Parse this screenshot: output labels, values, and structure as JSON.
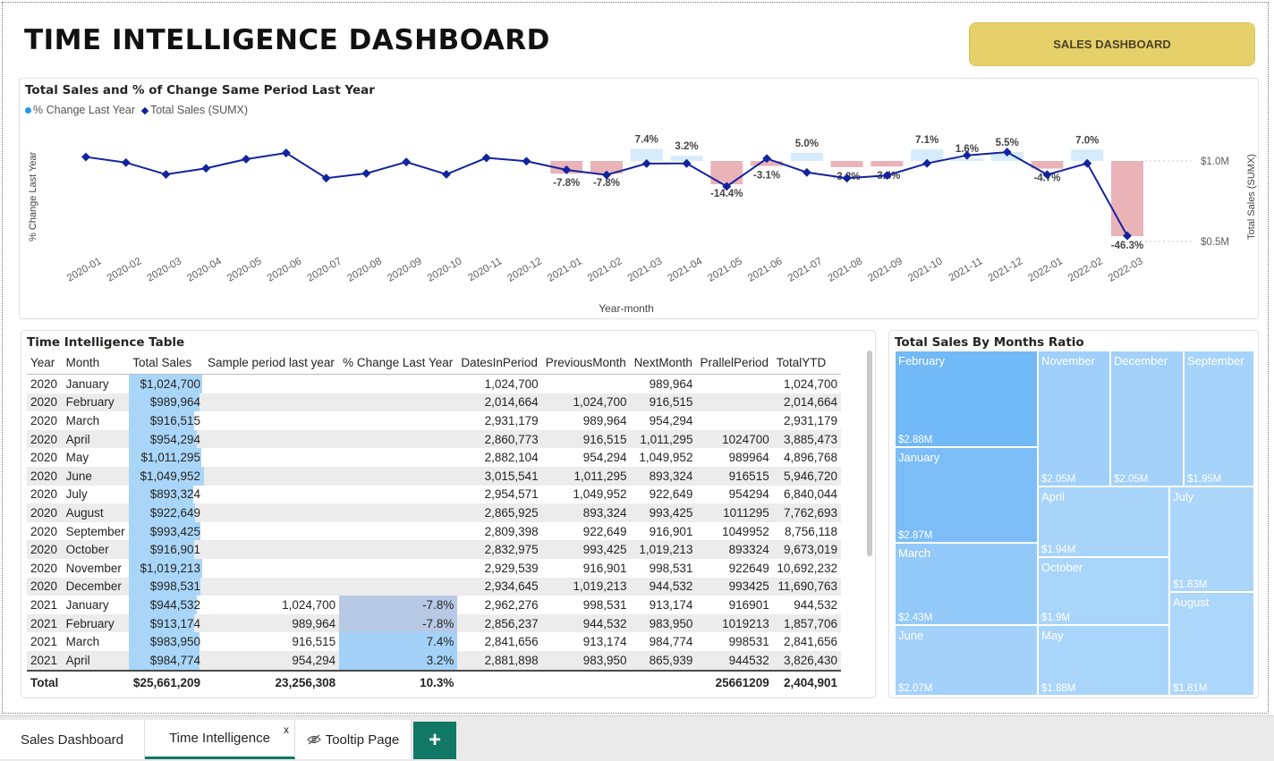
{
  "page_title": "TIME INTELLIGENCE DASHBOARD",
  "nav_button": "SALES DASHBOARD",
  "line_chart": {
    "title": "Total Sales and % of Change Same Period Last Year",
    "legend": [
      "% Change Last Year",
      "Total Sales (SUMX)"
    ],
    "left_axis_label": "% Change Last Year",
    "right_axis_label": "Total Sales (SUMX)",
    "right_ticks": [
      "$1.0M",
      "$0.5M"
    ],
    "x_axis_label": "Year-month"
  },
  "chart_data": {
    "type": "line",
    "x": [
      "2020-01",
      "2020-02",
      "2020-03",
      "2020-04",
      "2020-05",
      "2020-06",
      "2020-07",
      "2020-08",
      "2020-09",
      "2020-10",
      "2020-11",
      "2020-12",
      "2021-01",
      "2021-02",
      "2021-03",
      "2021-04",
      "2021-05",
      "2021-06",
      "2021-07",
      "2021-08",
      "2021-09",
      "2021-10",
      "2021-11",
      "2021-12",
      "2022-01",
      "2022-02",
      "2022-03"
    ],
    "series": [
      {
        "name": "Total Sales (SUMX)",
        "kind": "line",
        "axis": "right",
        "values": [
          1024700,
          989964,
          916515,
          954294,
          1011295,
          1049952,
          893324,
          922649,
          993425,
          916901,
          1019213,
          998531,
          944532,
          913174,
          983950,
          984774,
          842000,
          1015000,
          929000,
          893000,
          910000,
          985000,
          1035000,
          1055000,
          915000,
          985000,
          535000
        ]
      },
      {
        "name": "% Change Last Year",
        "kind": "bar",
        "axis": "left",
        "values": [
          null,
          null,
          null,
          null,
          null,
          null,
          null,
          null,
          null,
          null,
          null,
          null,
          -7.8,
          -7.8,
          7.4,
          3.2,
          -14.4,
          -3.1,
          5.0,
          -3.8,
          -3.4,
          7.1,
          1.6,
          5.5,
          -4.7,
          7.0,
          -46.3
        ],
        "labels": [
          "",
          "",
          "",
          "",
          "",
          "",
          "",
          "",
          "",
          "",
          "",
          "",
          "-7.8%",
          "-7.8%",
          "7.4%",
          "3.2%",
          "-14.4%",
          "-3.1%",
          "5.0%",
          "-3.8%",
          "-3.4%",
          "7.1%",
          "1.6%",
          "5.5%",
          "-4.7%",
          "7.0%",
          "-46.3%"
        ]
      }
    ],
    "right_axis_ticks": [
      1000000,
      500000
    ],
    "colors": {
      "line": "#12239e",
      "bar_negative": "#eab3b8",
      "bar_positive": "#d6ebfb"
    }
  },
  "table": {
    "title": "Time Intelligence Table",
    "headers": [
      "Year",
      "Month",
      "Total Sales",
      "Sample period last year",
      "% Change Last Year",
      "DatesInPeriod",
      "PreviousMonth",
      "NextMonth",
      "PrallelPeriod",
      "TotalYTD"
    ],
    "rows": [
      [
        "2020",
        "January",
        "$1,024,700",
        "",
        "",
        "1,024,700",
        "",
        "989,964",
        "",
        "1,024,700"
      ],
      [
        "2020",
        "February",
        "$989,964",
        "",
        "",
        "2,014,664",
        "1,024,700",
        "916,515",
        "",
        "2,014,664"
      ],
      [
        "2020",
        "March",
        "$916,515",
        "",
        "",
        "2,931,179",
        "989,964",
        "954,294",
        "",
        "2,931,179"
      ],
      [
        "2020",
        "April",
        "$954,294",
        "",
        "",
        "2,860,773",
        "916,515",
        "1,011,295",
        "1024700",
        "3,885,473"
      ],
      [
        "2020",
        "May",
        "$1,011,295",
        "",
        "",
        "2,882,104",
        "954,294",
        "1,049,952",
        "989964",
        "4,896,768"
      ],
      [
        "2020",
        "June",
        "$1,049,952",
        "",
        "",
        "3,015,541",
        "1,011,295",
        "893,324",
        "916515",
        "5,946,720"
      ],
      [
        "2020",
        "July",
        "$893,324",
        "",
        "",
        "2,954,571",
        "1,049,952",
        "922,649",
        "954294",
        "6,840,044"
      ],
      [
        "2020",
        "August",
        "$922,649",
        "",
        "",
        "2,865,925",
        "893,324",
        "993,425",
        "1011295",
        "7,762,693"
      ],
      [
        "2020",
        "September",
        "$993,425",
        "",
        "",
        "2,809,398",
        "922,649",
        "916,901",
        "1049952",
        "8,756,118"
      ],
      [
        "2020",
        "October",
        "$916,901",
        "",
        "",
        "2,832,975",
        "993,425",
        "1,019,213",
        "893324",
        "9,673,019"
      ],
      [
        "2020",
        "November",
        "$1,019,213",
        "",
        "",
        "2,929,539",
        "916,901",
        "998,531",
        "922649",
        "10,692,232"
      ],
      [
        "2020",
        "December",
        "$998,531",
        "",
        "",
        "2,934,645",
        "1,019,213",
        "944,532",
        "993425",
        "11,690,763"
      ],
      [
        "2021",
        "January",
        "$944,532",
        "1,024,700",
        "-7.8%",
        "2,962,276",
        "998,531",
        "913,174",
        "916901",
        "944,532"
      ],
      [
        "2021",
        "February",
        "$913,174",
        "989,964",
        "-7.8%",
        "2,856,237",
        "944,532",
        "983,950",
        "1019213",
        "1,857,706"
      ],
      [
        "2021",
        "March",
        "$983,950",
        "916,515",
        "7.4%",
        "2,841,656",
        "913,174",
        "984,774",
        "998531",
        "2,841,656"
      ],
      [
        "2021",
        "April",
        "$984,774",
        "954,294",
        "3.2%",
        "2,881,898",
        "983,950",
        "865,939",
        "944532",
        "3,826,430"
      ]
    ],
    "sales_values": [
      1024700,
      989964,
      916515,
      954294,
      1011295,
      1049952,
      893324,
      922649,
      993425,
      916901,
      1019213,
      998531,
      944532,
      913174,
      983950,
      984774
    ],
    "change_values": [
      null,
      null,
      null,
      null,
      null,
      null,
      null,
      null,
      null,
      null,
      null,
      null,
      -7.8,
      -7.8,
      7.4,
      3.2
    ],
    "total": [
      "Total",
      "",
      "$25,661,209",
      "23,256,308",
      "10.3%",
      "",
      "",
      "",
      "25661209",
      "2,404,901"
    ]
  },
  "treemap": {
    "title": "Total Sales By Months Ratio",
    "tiles": [
      {
        "label": "February",
        "value": "$2.88M"
      },
      {
        "label": "January",
        "value": "$2.87M"
      },
      {
        "label": "March",
        "value": "$2.43M"
      },
      {
        "label": "June",
        "value": "$2.07M"
      },
      {
        "label": "November",
        "value": "$2.05M"
      },
      {
        "label": "December",
        "value": "$2.05M"
      },
      {
        "label": "September",
        "value": "$1.95M"
      },
      {
        "label": "April",
        "value": "$1.94M"
      },
      {
        "label": "October",
        "value": "$1.9M"
      },
      {
        "label": "May",
        "value": "$1.88M"
      },
      {
        "label": "July",
        "value": "$1.83M"
      },
      {
        "label": "August",
        "value": "$1.81M"
      }
    ]
  },
  "tabs": [
    "Sales Dashboard",
    "Time Intelligence",
    "Tooltip Page"
  ],
  "tab_close": "x",
  "add_tab": "+"
}
